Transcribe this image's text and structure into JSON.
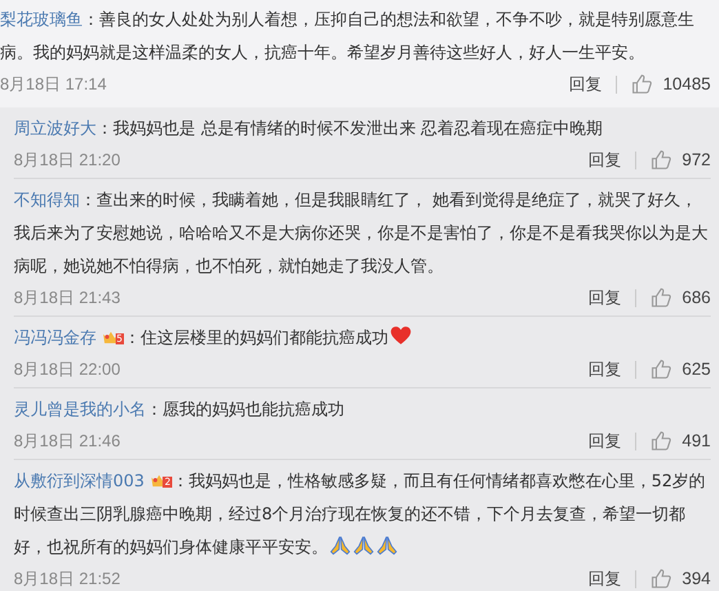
{
  "main_comment": {
    "user": "梨花玻璃鱼",
    "text": "：善良的女人处处为别人着想，压抑自己的想法和欲望，不争不吵，就是特别愿意生病。我的妈妈就是这样温柔的女人，抗癌十年。希望岁月善待这些好人，好人一生平安。",
    "time": "8月18日 17:14",
    "reply": "回复",
    "likes": "10485"
  },
  "replies": [
    {
      "user": "周立波好大",
      "text": "：我妈妈也是 总是有情绪的时候不发泄出来 忍着忍着现在癌症中晚期",
      "time": "8月18日 21:20",
      "reply": "回复",
      "likes": "972"
    },
    {
      "user": "不知得知",
      "text": "：查出来的时候，我瞒着她，但是我眼睛红了， 她看到觉得是绝症了，就哭了好久，我后来为了安慰她说，哈哈哈又不是大病你还哭，你是不是害怕了，你是不是看我哭你以为是大病呢，她说她不怕得病，也不怕死，就怕她走了我没人管。",
      "time": "8月18日 21:43",
      "reply": "回复",
      "likes": "686"
    },
    {
      "user": "冯冯冯金存",
      "badge": "5",
      "text": "：住这层楼里的妈妈们都能抗癌成功",
      "emoji": [
        {
          "kind": "heart"
        }
      ],
      "time": "8月18日 22:00",
      "reply": "回复",
      "likes": "625"
    },
    {
      "user": "灵儿曾是我的小名",
      "text": "：愿我的妈妈也能抗癌成功",
      "time": "8月18日 21:46",
      "reply": "回复",
      "likes": "491"
    },
    {
      "user": "从敷衍到深情003",
      "badge": "2",
      "text": "：我妈妈也是，性格敏感多疑，而且有任何情绪都喜欢憋在心里，52岁的时候查出三阴乳腺癌中晚期，经过8个月治疗现在恢复的还不错，下个月去复查，希望一切都好，也祝所有的妈妈们身体健康平平安安。",
      "emoji": [
        {
          "kind": "pray"
        },
        {
          "kind": "pray"
        },
        {
          "kind": "pray"
        }
      ],
      "time": "8月18日 21:52",
      "reply": "回复",
      "likes": "394"
    }
  ]
}
